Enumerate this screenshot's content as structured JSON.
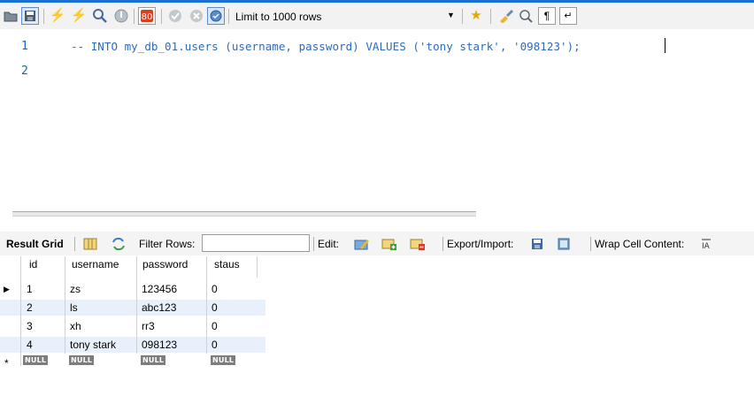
{
  "toolbar": {
    "limit_label": "Limit to 1000 rows"
  },
  "editor": {
    "line_numbers": [
      "1",
      "2"
    ],
    "code_line_1": "-- INTO my_db_01.users (username, password) VALUES ('tony stark', '098123');"
  },
  "result_bar": {
    "result_grid_label": "Result Grid",
    "filter_label": "Filter Rows:",
    "filter_value": "",
    "edit_label": "Edit:",
    "export_label": "Export/Import:",
    "wrap_label": "Wrap Cell Content:"
  },
  "grid": {
    "columns": [
      "id",
      "username",
      "password",
      "staus"
    ],
    "rows": [
      [
        "1",
        "zs",
        "123456",
        "0"
      ],
      [
        "2",
        "ls",
        "abc123",
        "0"
      ],
      [
        "3",
        "xh",
        "rr3",
        "0"
      ],
      [
        "4",
        "tony stark",
        "098123",
        "0"
      ]
    ],
    "null_label": "NULL",
    "current_row_marker": "▶",
    "new_row_marker": "*"
  },
  "colors": {
    "accent": "#1a6fd4",
    "stripe": "#e8f0fb",
    "code": "#2d6bb8"
  }
}
